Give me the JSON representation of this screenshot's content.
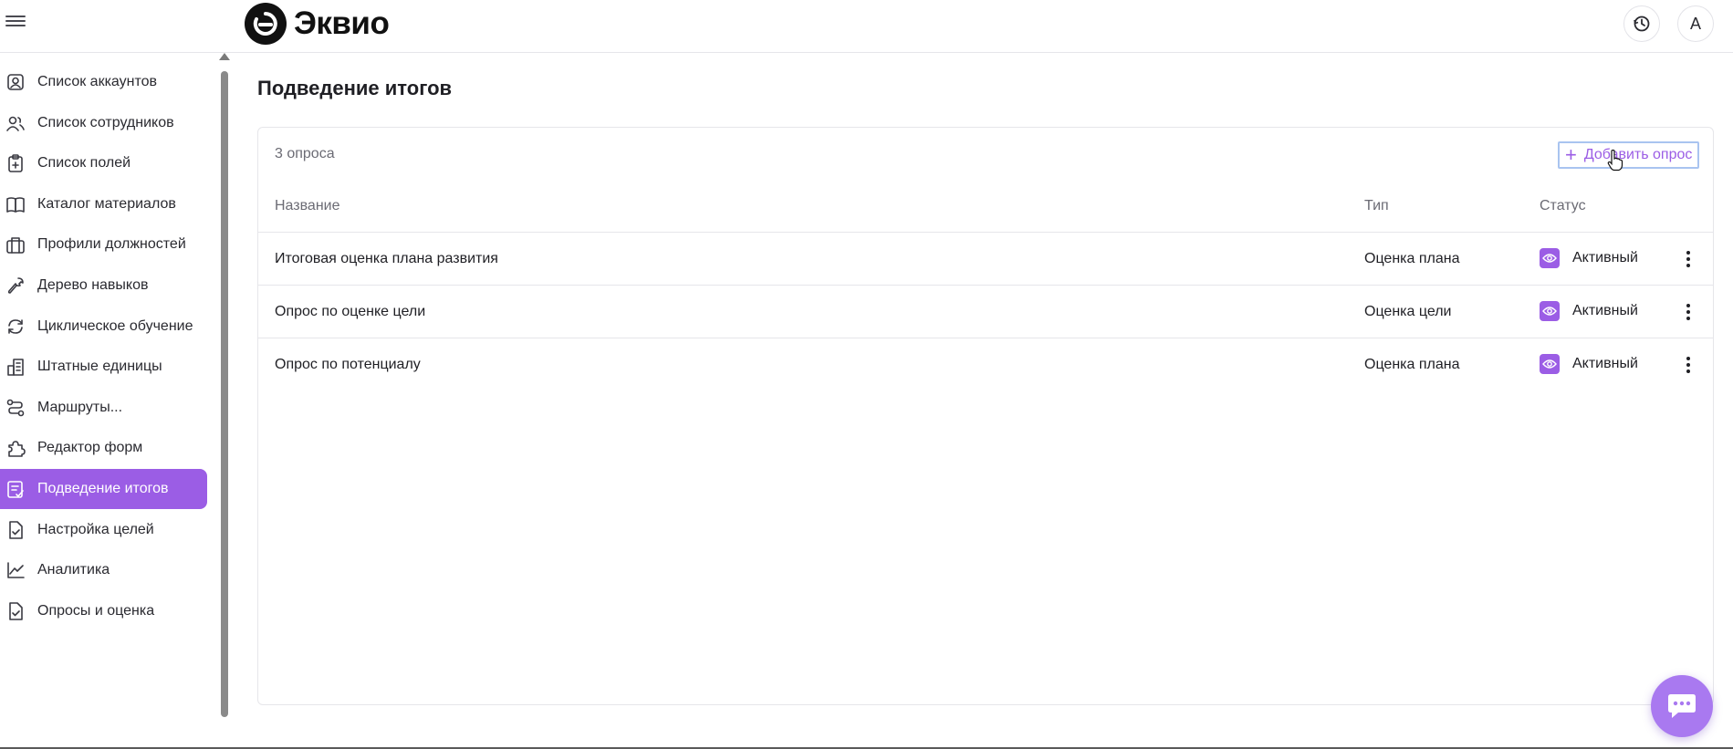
{
  "app": {
    "logo_text": "Эквио",
    "avatar_letter": "А"
  },
  "sidebar": {
    "items": [
      {
        "label": "Список аккаунтов",
        "icon": "account-icon"
      },
      {
        "label": "Список сотрудников",
        "icon": "users-icon"
      },
      {
        "label": "Список полей",
        "icon": "clipboard-plus-icon"
      },
      {
        "label": "Каталог материалов",
        "icon": "book-icon"
      },
      {
        "label": "Профили должностей",
        "icon": "briefcase-icon"
      },
      {
        "label": "Дерево навыков",
        "icon": "wrench-icon"
      },
      {
        "label": "Циклическое обучение",
        "icon": "refresh-icon"
      },
      {
        "label": "Штатные единицы",
        "icon": "building-icon"
      },
      {
        "label": "Маршруты...",
        "icon": "route-icon"
      },
      {
        "label": "Редактор форм",
        "icon": "puzzle-icon"
      },
      {
        "label": "Подведение итогов",
        "icon": "summary-icon",
        "active": true
      },
      {
        "label": "Настройка целей",
        "icon": "file-check-icon"
      },
      {
        "label": "Аналитика",
        "icon": "chart-line-icon"
      },
      {
        "label": "Опросы и оценка",
        "icon": "survey-icon"
      }
    ]
  },
  "main": {
    "title": "Подведение итогов",
    "count_text": "3 опроса",
    "add_button": "Добавить опрос",
    "columns": {
      "name": "Название",
      "type": "Тип",
      "status": "Статус"
    },
    "rows": [
      {
        "name": "Итоговая оценка плана развития",
        "type": "Оценка плана",
        "status": "Активный"
      },
      {
        "name": "Опрос по оценке цели",
        "type": "Оценка цели",
        "status": "Активный"
      },
      {
        "name": "Опрос по потенциалу",
        "type": "Оценка плана",
        "status": "Активный"
      }
    ]
  },
  "colors": {
    "accent": "#9b5de5",
    "chat": "#a979f0",
    "focus_ring": "#a9c4f0"
  }
}
